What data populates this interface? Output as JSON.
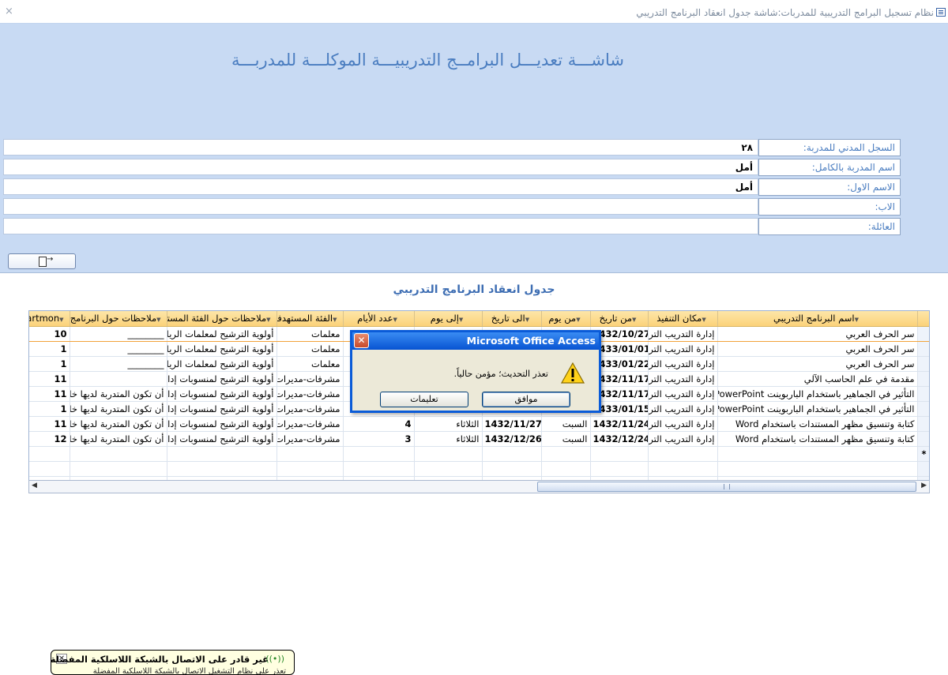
{
  "window": {
    "title": "نظام تسجيل البرامج التدريبية للمدربات:شاشة جدول انعقاد البرنامج التدريبي",
    "close_glyph": "×"
  },
  "form": {
    "main_title": "شاشـــة تعديـــل البرامــج التدريبيـــة الموكلـــة للمدربـــة",
    "sub_title": "جدول انعقاد البرنامج التدريبي",
    "fields": [
      {
        "label": "السجل المدني للمدربة:",
        "value": "٢٨"
      },
      {
        "label": "اسم المدربة بالكامل:",
        "value": "أمل"
      },
      {
        "label": "الاسم الاول:",
        "value": "أمل"
      },
      {
        "label": "الاب:",
        "value": ""
      },
      {
        "label": "العائلة:",
        "value": ""
      }
    ],
    "exit_button_icon": "exit-door-icon"
  },
  "grid": {
    "headers": {
      "program": "اسم البرنامج التدريبي",
      "place": "مكان التنفيذ",
      "from_date": "من تاريخ",
      "from_day": "من يوم",
      "to_date": "الى تاريخ",
      "to_day": "إلى يوم",
      "days": "عدد الأيام",
      "audience": "الفئة المستهدفه",
      "audience_notes": "ملاحظات حول الفئة المستر",
      "program_notes": "ملاحظات حول البرنامج",
      "startmon": "tartmon"
    },
    "rows": [
      {
        "program": "سر الحرف العربي",
        "place": "إدارة التدريب التربو",
        "from_date": "1432/10/27",
        "from_day": "",
        "to_date": "",
        "to_day": "",
        "days": "",
        "audience": "معلمات",
        "audience_notes": "أولوية الترشيح لمعلمات الرياض",
        "program_notes": "________",
        "startmon": "10"
      },
      {
        "program": "سر الحرف العربي",
        "place": "إدارة التدريب التربو",
        "from_date": "1433/01/01",
        "from_day": "",
        "to_date": "",
        "to_day": "",
        "days": "",
        "audience": "معلمات",
        "audience_notes": "أولوية الترشيح لمعلمات الرياض",
        "program_notes": "________",
        "startmon": "1"
      },
      {
        "program": "سر الحرف العربي",
        "place": "إدارة التدريب التربو",
        "from_date": "1433/01/22",
        "from_day": "",
        "to_date": "",
        "to_day": "",
        "days": "",
        "audience": "معلمات",
        "audience_notes": "أولوية الترشيح لمعلمات الرياض",
        "program_notes": "________",
        "startmon": "1"
      },
      {
        "program": "مقدمة في علم الحاسب الآلي",
        "place": "إدارة التدريب التربو",
        "from_date": "1432/11/17",
        "from_day": "",
        "to_date": "",
        "to_day": "",
        "days": "",
        "audience": "مشرفات-مديرات-",
        "audience_notes": "أولوية الترشيح لمنسوبات إدارة",
        "program_notes": "",
        "startmon": "11"
      },
      {
        "program": "التأثير في الجماهير باستخدام الباربوينت PowerPoint",
        "place": "إدارة التدريب التربو",
        "from_date": "1432/11/17",
        "from_day": "",
        "to_date": "",
        "to_day": "",
        "days": "",
        "audience": "مشرفات-مديرات-",
        "audience_notes": "أولوية الترشيح لمنسوبات إدارة",
        "program_notes": "أن تكون المتدربة لديها خلفية",
        "startmon": "11"
      },
      {
        "program": "التأثير في الجماهير باستخدام الباربوينت PowerPoint",
        "place": "إدارة التدريب التربو",
        "from_date": "1433/01/15",
        "from_day": "",
        "to_date": "",
        "to_day": "",
        "days": "",
        "audience": "مشرفات-مديرات-",
        "audience_notes": "أولوية الترشيح لمنسوبات إدارة",
        "program_notes": "أن تكون المتدربة لديها خلفية",
        "startmon": "1"
      },
      {
        "program": "كتابة وتنسيق مظهر المستندات باستخدام Word",
        "place": "إدارة التدريب التربو",
        "from_date": "1432/11/24",
        "from_day": "السبت",
        "to_date": "1432/11/27",
        "to_day": "الثلاثاء",
        "days": "4",
        "audience": "مشرفات-مديرات-",
        "audience_notes": "أولوية الترشيح لمنسوبات إدارة",
        "program_notes": "أن تكون المتدربة لديها خلفية",
        "startmon": "11"
      },
      {
        "program": "كتابة وتنسيق مظهر المستندات باستخدام Word",
        "place": "إدارة التدريب التربو",
        "from_date": "1432/12/24",
        "from_day": "السبت",
        "to_date": "1432/12/26",
        "to_day": "الثلاثاء",
        "days": "3",
        "audience": "مشرفات-مديرات-",
        "audience_notes": "أولوية الترشيح لمنسوبات إدارة",
        "program_notes": "أن تكون المتدربة لديها خلفية",
        "startmon": "12"
      }
    ],
    "new_row_marker": "*"
  },
  "dialog": {
    "title": "Microsoft Office Access",
    "message": "تعذر التحديث؛ مؤمن حالياً.",
    "ok_label": "موافق",
    "help_label": "تعليمات",
    "icon": "warning-icon"
  },
  "balloon": {
    "title": "غير قادر على الاتصال بالشبكة اللاسلكية المفضلة",
    "body": "تعذر على نظام التشغيل الاتصال بالشبكة اللاسلكية المفضلة",
    "icon": "wireless-network-icon"
  }
}
